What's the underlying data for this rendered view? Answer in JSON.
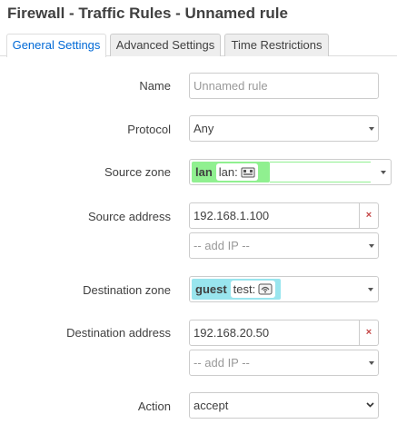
{
  "page": {
    "title": "Firewall - Traffic Rules - Unnamed rule"
  },
  "tabs": [
    {
      "label": "General Settings",
      "active": true
    },
    {
      "label": "Advanced Settings",
      "active": false
    },
    {
      "label": "Time Restrictions",
      "active": false
    }
  ],
  "form": {
    "name": {
      "label": "Name",
      "placeholder": "Unnamed rule",
      "value": ""
    },
    "protocol": {
      "label": "Protocol",
      "value": "Any"
    },
    "source_zone": {
      "label": "Source zone",
      "zone": "lan",
      "networks": "lan:",
      "zone_color": "#90f090",
      "network_icon": "ethernet-ports-icon"
    },
    "source_address": {
      "label": "Source address",
      "value": "192.168.1.100",
      "add_placeholder": "-- add IP --",
      "clear_label": "×"
    },
    "destination_zone": {
      "label": "Destination zone",
      "zone": "guest",
      "networks": "test:",
      "zone_color": "#99e5ee",
      "network_icon": "wireless-network-icon"
    },
    "destination_address": {
      "label": "Destination address",
      "value": "192.168.20.50",
      "add_placeholder": "-- add IP --",
      "clear_label": "×"
    },
    "action": {
      "label": "Action",
      "value": "accept"
    }
  },
  "colors": {
    "active_tab_text": "#0069d6",
    "clear_button": "#c44444"
  }
}
